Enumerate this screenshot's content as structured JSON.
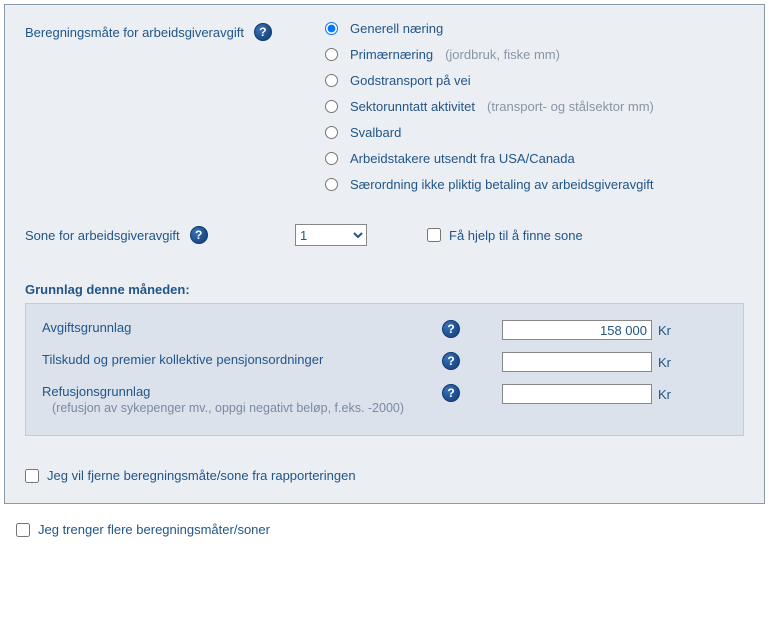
{
  "beregningsmate": {
    "label": "Beregningsmåte for arbeidsgiveravgift",
    "options": [
      {
        "label": "Generell næring",
        "hint": ""
      },
      {
        "label": "Primærnæring",
        "hint": "(jordbruk, fiske mm)"
      },
      {
        "label": "Godstransport på vei",
        "hint": ""
      },
      {
        "label": "Sektorunntatt aktivitet",
        "hint": "(transport- og stålsektor mm)"
      },
      {
        "label": "Svalbard",
        "hint": ""
      },
      {
        "label": "Arbeidstakere utsendt fra USA/Canada",
        "hint": ""
      },
      {
        "label": "Særordning ikke pliktig betaling av arbeidsgiveravgift",
        "hint": ""
      }
    ]
  },
  "sone": {
    "label": "Sone for arbeidsgiveravgift",
    "selected": "1",
    "help_checkbox_label": "Få hjelp til å finne sone"
  },
  "grunnlag": {
    "header": "Grunnlag denne måneden:",
    "rows": [
      {
        "label": "Avgiftsgrunnlag",
        "sublabel": "",
        "value": "158 000",
        "suffix": "Kr"
      },
      {
        "label": "Tilskudd og premier kollektive pensjonsordninger",
        "sublabel": "",
        "value": "",
        "suffix": "Kr"
      },
      {
        "label": "Refusjonsgrunnlag",
        "sublabel": "(refusjon av sykepenger mv., oppgi negativt beløp, f.eks. -2000)",
        "value": "",
        "suffix": "Kr"
      }
    ]
  },
  "remove_check_label": "Jeg vil fjerne beregningsmåte/sone fra rapporteringen",
  "more_check_label": "Jeg trenger flere beregningsmåter/soner"
}
